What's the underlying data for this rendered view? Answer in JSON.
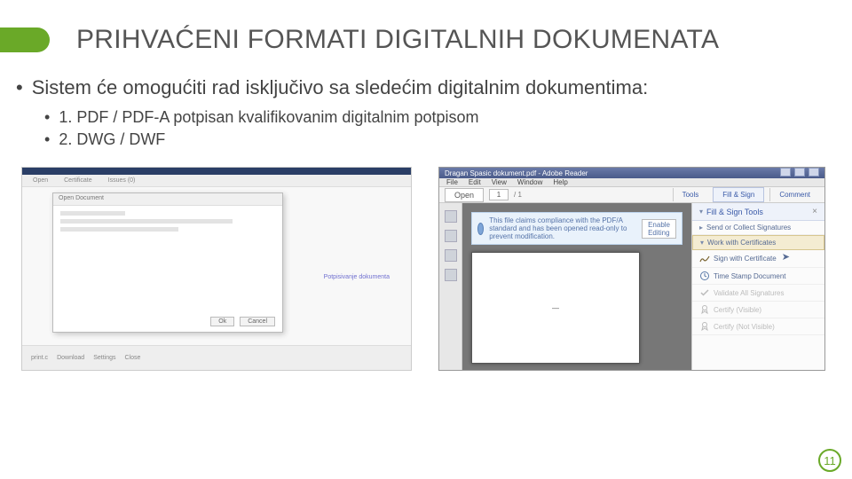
{
  "slide": {
    "title": "PRIHVAĆENI FORMATI DIGITALNIH DOKUMENATA",
    "bullet1": "Sistem će omogućiti rad isključivo sa sledećim digitalnim dokumentima:",
    "sub1": "1. PDF / PDF-A potpisan kvalifikovanim digitalnim potpisom",
    "sub2": "2. DWG / DWF",
    "number": "11"
  },
  "left_shot": {
    "tabs": [
      "Open",
      "Certificate",
      "Issues (0)"
    ],
    "dialog_title": "Open Document",
    "link": "Potpisivanje dokumenta",
    "btn_ok": "Ok",
    "btn_cancel": "Cancel",
    "footer_items": [
      "print.c",
      "Download",
      "Settings",
      "Close"
    ]
  },
  "adobe": {
    "window_title": "Dragan Spasic dokument.pdf - Adobe Reader",
    "menu": [
      "File",
      "Edit",
      "View",
      "Window",
      "Help"
    ],
    "toolbar": {
      "open": "Open",
      "page": "1",
      "of": "/ 1",
      "tools": "Tools",
      "fill": "Fill & Sign",
      "comment": "Comment"
    },
    "notice_text": "This file claims compliance with the PDF/A standard and has been opened read-only to prevent modification.",
    "enable": "Enable Editing",
    "page_text": "—",
    "right_pane": {
      "head": "Fill & Sign Tools",
      "group1": "Send or Collect Signatures",
      "group2": "Work with Certificates",
      "item_sign": "Sign with Certificate",
      "item_time": "Time Stamp Document",
      "item_validate": "Validate All Signatures",
      "item_certify_v": "Certify (Visible)",
      "item_certify_i": "Certify (Not Visible)"
    }
  }
}
